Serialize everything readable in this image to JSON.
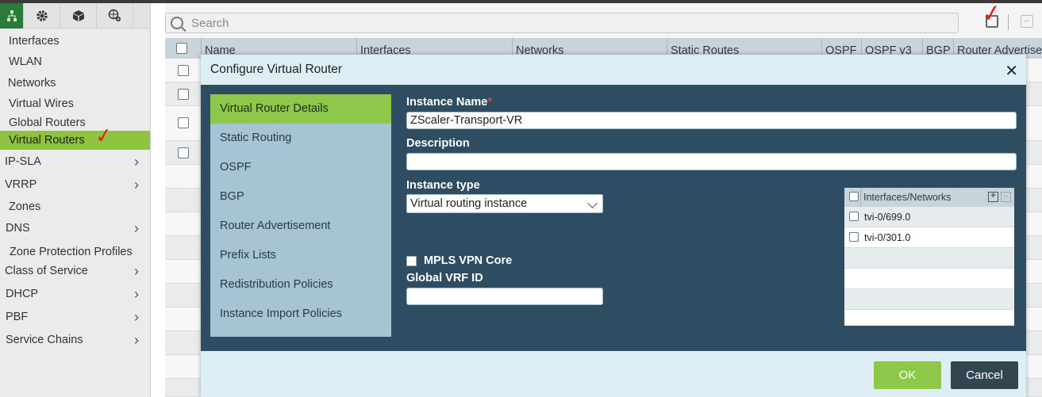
{
  "sidebar": {
    "tabs": [
      "network-icon",
      "gear-icon",
      "cube-icon",
      "globe-gear-icon"
    ],
    "items": [
      {
        "label": "Interfaces",
        "has_children": false
      },
      {
        "label": "WLAN",
        "has_children": false
      },
      {
        "label": "Networks",
        "has_children": false
      },
      {
        "label": "Virtual Wires",
        "has_children": false
      },
      {
        "label": "Global Routers",
        "has_children": false
      },
      {
        "label": "Virtual Routers",
        "has_children": false,
        "active": true
      },
      {
        "label": "IP-SLA",
        "has_children": true
      },
      {
        "label": "VRRP",
        "has_children": true
      },
      {
        "label": "Zones",
        "has_children": false
      },
      {
        "label": "DNS",
        "has_children": true
      },
      {
        "label": "Zone Protection Profiles",
        "has_children": false
      },
      {
        "label": "Class of Service",
        "has_children": true
      },
      {
        "label": "DHCP",
        "has_children": true
      },
      {
        "label": "PBF",
        "has_children": true
      },
      {
        "label": "Service Chains",
        "has_children": true
      }
    ]
  },
  "search": {
    "placeholder": "Search"
  },
  "grid": {
    "columns": [
      "Name",
      "Interfaces",
      "Networks",
      "Static Routes",
      "OSPF",
      "OSPF v3",
      "BGP",
      "Router Advertisement"
    ]
  },
  "modal": {
    "title": "Configure Virtual Router",
    "nav": [
      "Virtual Router Details",
      "Static Routing",
      "OSPF",
      "BGP",
      "Router Advertisement",
      "Prefix Lists",
      "Redistribution Policies",
      "Instance Import Policies"
    ],
    "instance_name_label": "Instance Name",
    "required_mark": "*",
    "instance_name_value": "ZScaler-Transport-VR",
    "description_label": "Description",
    "description_value": "",
    "instance_type_label": "Instance type",
    "instance_type_value": "Virtual routing instance",
    "mpls_label": "MPLS VPN Core",
    "mpls_checked": false,
    "global_vrf_label": "Global VRF ID",
    "global_vrf_value": "",
    "interfaces_header": "Interfaces/Networks",
    "interfaces": [
      "tvi-0/699.0",
      "tvi-0/301.0"
    ],
    "ok_label": "OK",
    "cancel_label": "Cancel"
  },
  "colors": {
    "accent_green": "#8dc84a",
    "modal_body": "#2e4d63",
    "nav_panel": "#a7c4d4",
    "annotation_red": "#e0201b"
  }
}
